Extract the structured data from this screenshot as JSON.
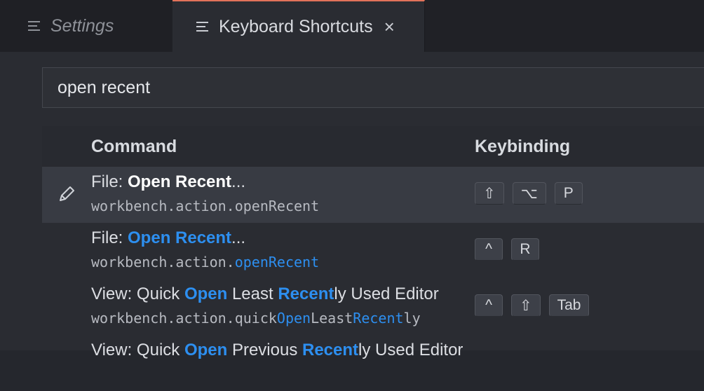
{
  "tabs": [
    {
      "label": "Settings"
    },
    {
      "label": "Keyboard Shortcuts",
      "close": "×"
    }
  ],
  "search": {
    "value": "open recent"
  },
  "table": {
    "headers": {
      "command": "Command",
      "keybinding": "Keybinding"
    },
    "rows": [
      {
        "title": [
          "File: ",
          "Open Recent",
          "..."
        ],
        "command_id": [
          "workbench.action.openRecent"
        ],
        "keys": [
          "⇧",
          "⌥",
          "P"
        ]
      },
      {
        "title": [
          "File: ",
          "Open Recent",
          "..."
        ],
        "command_id": [
          "workbench.action.",
          "openRecent"
        ],
        "keys": [
          "^",
          "R"
        ]
      },
      {
        "title": [
          "View: Quick ",
          "Open",
          " Least ",
          "Recent",
          "ly Used Editor"
        ],
        "command_id": [
          "workbench.action.quick",
          "Open",
          "Least",
          "Recent",
          "ly"
        ],
        "keys": [
          "^",
          "⇧",
          "Tab"
        ]
      },
      {
        "title": [
          "View: Quick ",
          "Open",
          " Previous ",
          "Recent",
          "ly Used Editor"
        ]
      }
    ]
  },
  "colors": {
    "accent": "#2d8ff0",
    "tab_border": "#e2725a",
    "selected_row": "#383b43"
  }
}
